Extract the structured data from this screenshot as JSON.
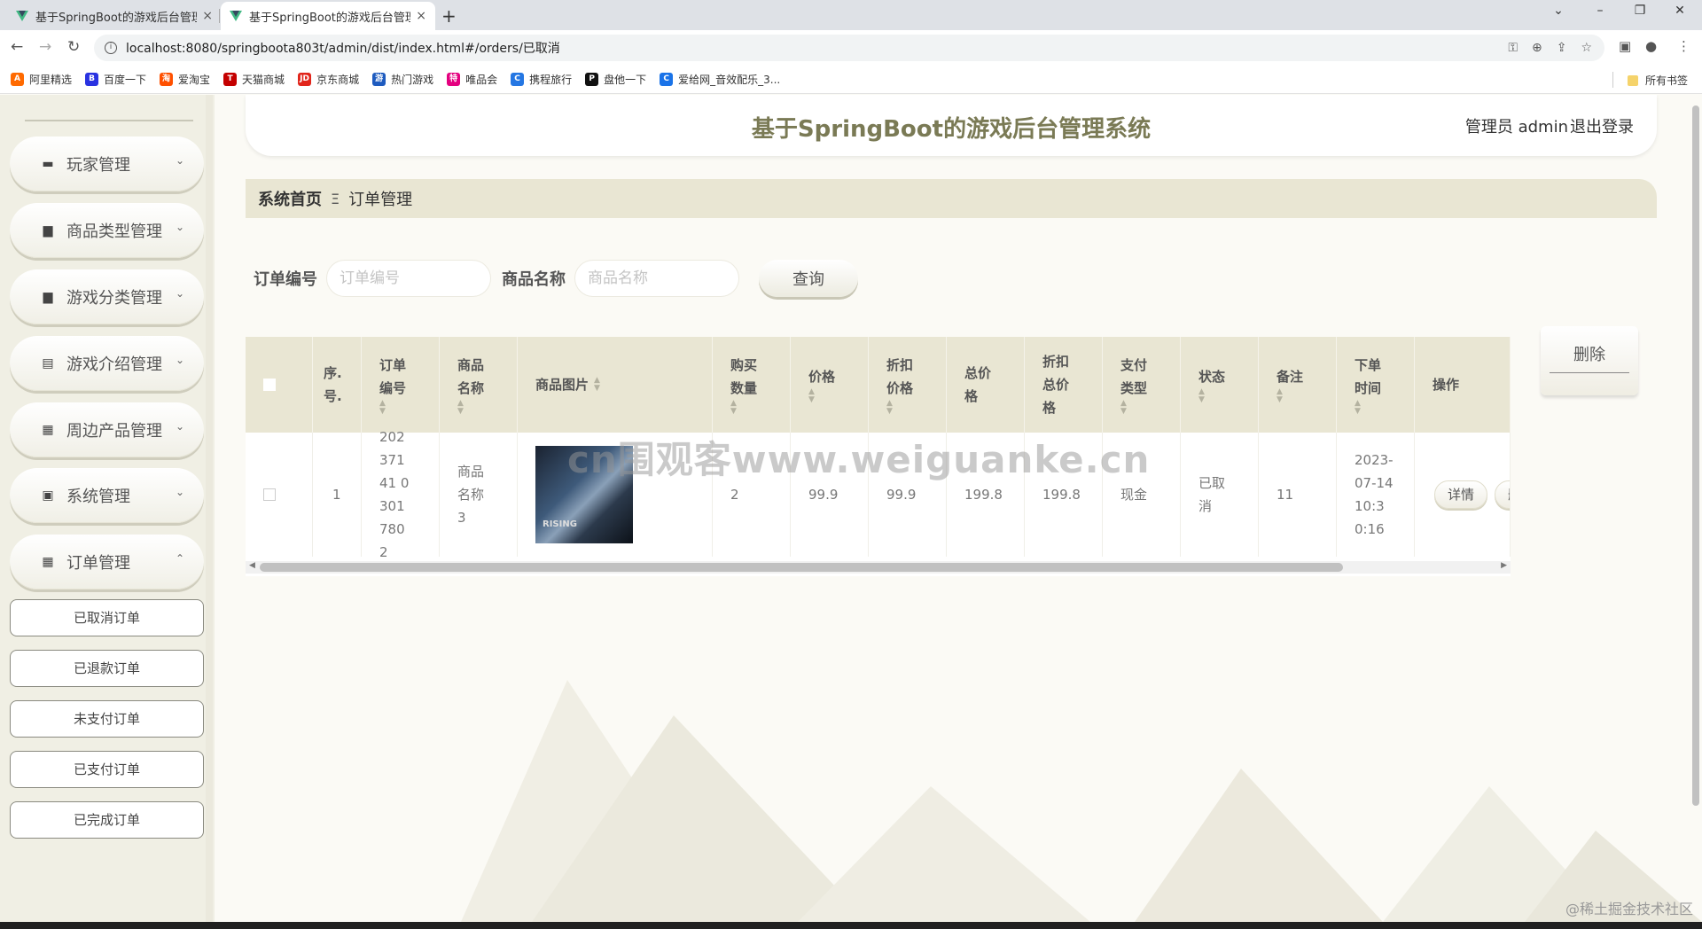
{
  "browser": {
    "tabs": [
      {
        "title": "基于SpringBoot的游戏后台管理",
        "close": "×"
      },
      {
        "title": "基于SpringBoot的游戏后台管理",
        "close": "×"
      }
    ],
    "new_tab": "+",
    "window_controls": {
      "chevron": "⌄",
      "minimize": "–",
      "restore": "❐",
      "close": "✕"
    },
    "url": "localhost:8080/springboota803t/admin/dist/index.html#/orders/已取消",
    "bookmarks": [
      {
        "label": "阿里精选",
        "icon": "ali-icon",
        "color": "#ff6a00",
        "glyph": "A"
      },
      {
        "label": "百度一下",
        "icon": "baidu-icon",
        "color": "#2932e1",
        "glyph": "B"
      },
      {
        "label": "爱淘宝",
        "icon": "taobao-icon",
        "color": "#ff5000",
        "glyph": "淘"
      },
      {
        "label": "天猫商城",
        "icon": "tmall-icon",
        "color": "#c40000",
        "glyph": "T"
      },
      {
        "label": "京东商城",
        "icon": "jd-icon",
        "color": "#e1251b",
        "glyph": "JD"
      },
      {
        "label": "热门游戏",
        "icon": "games-icon",
        "color": "#1e5bbf",
        "glyph": "游"
      },
      {
        "label": "唯品会",
        "icon": "vip-icon",
        "color": "#e4007f",
        "glyph": "特"
      },
      {
        "label": "携程旅行",
        "icon": "ctrip-icon",
        "color": "#2577e3",
        "glyph": "C"
      },
      {
        "label": "盘他一下",
        "icon": "pan-icon",
        "color": "#111111",
        "glyph": "P"
      },
      {
        "label": "爱给网_音效配乐_3...",
        "icon": "aigei-icon",
        "color": "#1a73e8",
        "glyph": "C"
      }
    ],
    "all_bookmarks": "所有书签"
  },
  "app": {
    "title": "基于SpringBoot的游戏后台管理系统",
    "user": "管理员 admin",
    "logout": "退出登录"
  },
  "sidebar": {
    "menus": [
      {
        "label": "玩家管理",
        "icon": "▬",
        "chev": "⌄"
      },
      {
        "label": "商品类型管理",
        "icon": "▆",
        "chev": "⌄"
      },
      {
        "label": "游戏分类管理",
        "icon": "▆",
        "chev": "⌄"
      },
      {
        "label": "游戏介绍管理",
        "icon": "▤",
        "chev": "⌄"
      },
      {
        "label": "周边产品管理",
        "icon": "▦",
        "chev": "⌄"
      },
      {
        "label": "系统管理",
        "icon": "▣",
        "chev": "⌄"
      },
      {
        "label": "订单管理",
        "icon": "▦",
        "chev": "⌃"
      }
    ],
    "submenu": [
      "已取消订单",
      "已退款订单",
      "未支付订单",
      "已支付订单",
      "已完成订单"
    ]
  },
  "breadcrumb": {
    "home": "系统首页",
    "separator": "Ξ",
    "current": "订单管理"
  },
  "search": {
    "order_label": "订单编号",
    "order_placeholder": "订单编号",
    "product_label": "商品名称",
    "product_placeholder": "商品名称",
    "button": "查询"
  },
  "delete_button": "删除",
  "table": {
    "headers": {
      "index": "序.号.",
      "order_no": "订单编号",
      "product_name": "商品名称",
      "product_image": "商品图片",
      "quantity": "购买数量",
      "price": "价格",
      "discount_price": "折扣价格",
      "total": "总价格",
      "discount_total": "折扣总价格",
      "pay_type": "支付类型",
      "status": "状态",
      "note": "备注",
      "order_time": "下单时间",
      "actions": "操作"
    },
    "rows": [
      {
        "index": "1",
        "order_no": "20237141 03017802",
        "product_name": "商品名称3",
        "quantity": "2",
        "price": "99.9",
        "discount_price": "99.9",
        "total": "199.8",
        "discount_total": "199.8",
        "pay_type": "现金",
        "status": "已取消",
        "note": "11",
        "order_time": "2023-07-14 10:30:16",
        "detail_btn": "详情",
        "delete_btn": "删"
      }
    ]
  },
  "watermark": "cn围观客www.weiguanke.cn",
  "corner_watermark": "@稀土掘金技术社区",
  "colors": {
    "accent": "#7a7a55",
    "header_bg": "#e9e6d3",
    "sidebar_bg": "#f0efe4"
  }
}
